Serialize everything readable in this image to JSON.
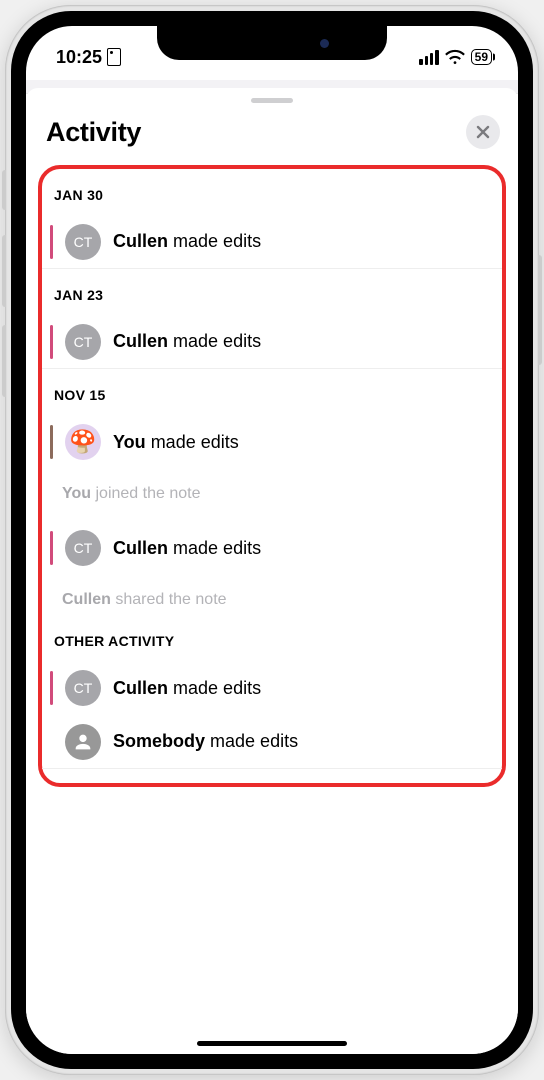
{
  "status": {
    "time": "10:25",
    "battery": "59"
  },
  "sheet": {
    "title": "Activity"
  },
  "sections": [
    {
      "header": "JAN 30",
      "items": [
        {
          "type": "edit",
          "avatar": "CT",
          "avatar_kind": "text",
          "actor": "Cullen",
          "text": "made edits",
          "bar": "pink"
        }
      ]
    },
    {
      "header": "JAN 23",
      "items": [
        {
          "type": "edit",
          "avatar": "CT",
          "avatar_kind": "text",
          "actor": "Cullen",
          "text": "made edits",
          "bar": "pink"
        }
      ]
    },
    {
      "header": "NOV 15",
      "items": [
        {
          "type": "edit",
          "avatar": "🍄",
          "avatar_kind": "you",
          "actor": "You",
          "text": "made edits",
          "bar": "brown"
        },
        {
          "type": "meta",
          "actor": "You",
          "text": "joined the note"
        },
        {
          "type": "edit",
          "avatar": "CT",
          "avatar_kind": "text",
          "actor": "Cullen",
          "text": "made edits",
          "bar": "pink"
        },
        {
          "type": "meta",
          "actor": "Cullen",
          "text": "shared the note"
        }
      ]
    },
    {
      "header": "OTHER ACTIVITY",
      "items": [
        {
          "type": "edit",
          "avatar": "CT",
          "avatar_kind": "text",
          "actor": "Cullen",
          "text": "made edits",
          "bar": "pink"
        },
        {
          "type": "edit",
          "avatar": "",
          "avatar_kind": "icon",
          "actor": "Somebody",
          "text": "made edits",
          "bar": "none"
        }
      ]
    }
  ]
}
